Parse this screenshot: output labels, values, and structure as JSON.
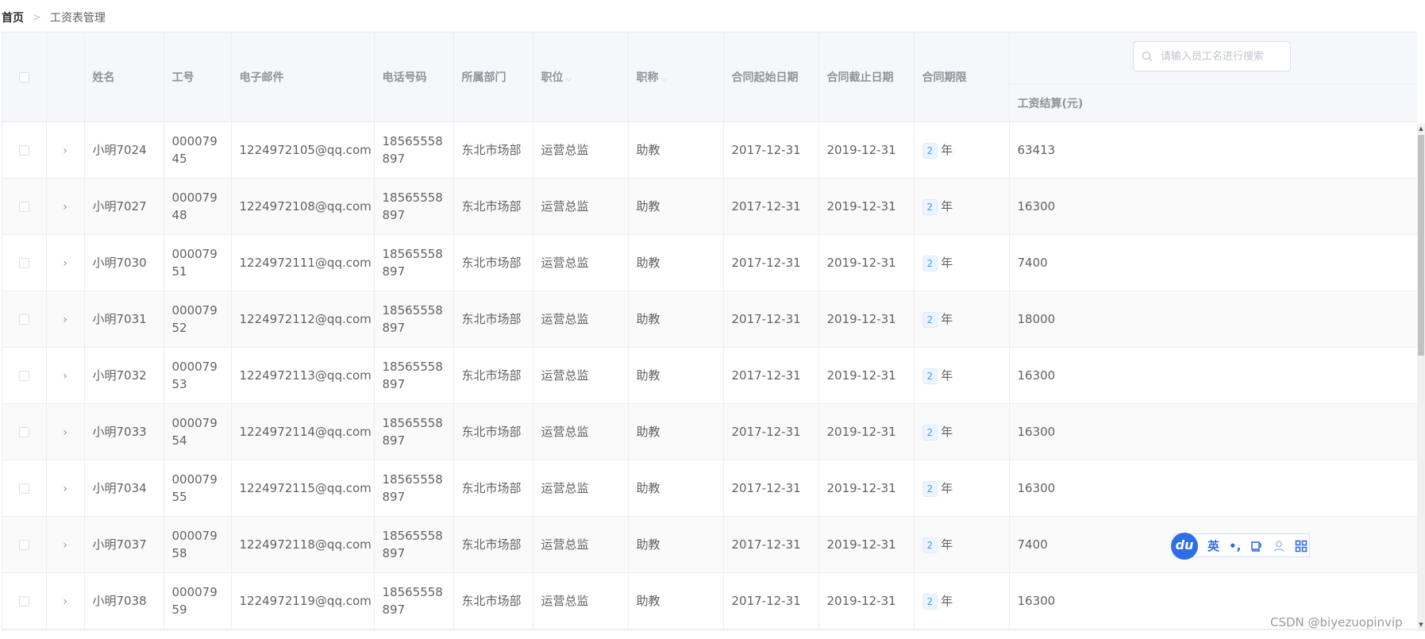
{
  "breadcrumb": {
    "home": "首页",
    "separator": ">",
    "current": "工资表管理"
  },
  "search": {
    "placeholder": "请输入员工名进行搜索"
  },
  "columns": {
    "name": "姓名",
    "job_no": "工号",
    "email": "电子邮件",
    "phone": "电话号码",
    "department": "所属部门",
    "position": "职位",
    "title": "职称",
    "contract_start": "合同起始日期",
    "contract_end": "合同截止日期",
    "contract_term": "合同期限",
    "salary": "工资结算(元)"
  },
  "term_unit": "年",
  "rows": [
    {
      "name": "小明7024",
      "job_no": "00007945",
      "email": "1224972105@qq.com",
      "phone": "18565558897",
      "department": "东北市场部",
      "position": "运营总监",
      "title": "助教",
      "start": "2017-12-31",
      "end": "2019-12-31",
      "term": "2",
      "salary": "63413"
    },
    {
      "name": "小明7027",
      "job_no": "00007948",
      "email": "1224972108@qq.com",
      "phone": "18565558897",
      "department": "东北市场部",
      "position": "运营总监",
      "title": "助教",
      "start": "2017-12-31",
      "end": "2019-12-31",
      "term": "2",
      "salary": "16300"
    },
    {
      "name": "小明7030",
      "job_no": "00007951",
      "email": "1224972111@qq.com",
      "phone": "18565558897",
      "department": "东北市场部",
      "position": "运营总监",
      "title": "助教",
      "start": "2017-12-31",
      "end": "2019-12-31",
      "term": "2",
      "salary": "7400"
    },
    {
      "name": "小明7031",
      "job_no": "00007952",
      "email": "1224972112@qq.com",
      "phone": "18565558897",
      "department": "东北市场部",
      "position": "运营总监",
      "title": "助教",
      "start": "2017-12-31",
      "end": "2019-12-31",
      "term": "2",
      "salary": "18000"
    },
    {
      "name": "小明7032",
      "job_no": "00007953",
      "email": "1224972113@qq.com",
      "phone": "18565558897",
      "department": "东北市场部",
      "position": "运营总监",
      "title": "助教",
      "start": "2017-12-31",
      "end": "2019-12-31",
      "term": "2",
      "salary": "16300"
    },
    {
      "name": "小明7033",
      "job_no": "00007954",
      "email": "1224972114@qq.com",
      "phone": "18565558897",
      "department": "东北市场部",
      "position": "运营总监",
      "title": "助教",
      "start": "2017-12-31",
      "end": "2019-12-31",
      "term": "2",
      "salary": "16300"
    },
    {
      "name": "小明7034",
      "job_no": "00007955",
      "email": "1224972115@qq.com",
      "phone": "18565558897",
      "department": "东北市场部",
      "position": "运营总监",
      "title": "助教",
      "start": "2017-12-31",
      "end": "2019-12-31",
      "term": "2",
      "salary": "16300"
    },
    {
      "name": "小明7037",
      "job_no": "00007958",
      "email": "1224972118@qq.com",
      "phone": "18565558897",
      "department": "东北市场部",
      "position": "运营总监",
      "title": "助教",
      "start": "2017-12-31",
      "end": "2019-12-31",
      "term": "2",
      "salary": "7400"
    },
    {
      "name": "小明7038",
      "job_no": "00007959",
      "email": "1224972119@qq.com",
      "phone": "18565558897",
      "department": "东北市场部",
      "position": "运营总监",
      "title": "助教",
      "start": "2017-12-31",
      "end": "2019-12-31",
      "term": "2",
      "salary": "16300"
    }
  ],
  "ime": {
    "logo": "du",
    "lang": "英",
    "punct": "•,",
    "icons": [
      "cup-icon",
      "user-icon",
      "grid-icon"
    ]
  },
  "watermark": "CSDN @biyezuopinvip",
  "colors": {
    "header_bg": "#f5f7fa",
    "border": "#ebeef5",
    "tag_blue": "#409eff",
    "ime_blue": "#2e6ee6"
  }
}
